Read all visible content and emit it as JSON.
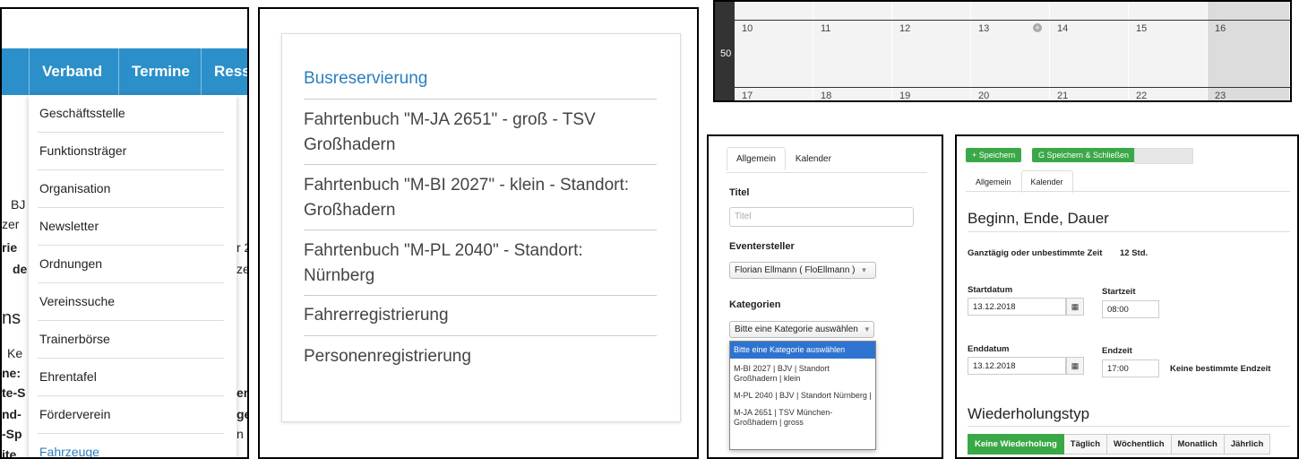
{
  "nav": {
    "tabs": [
      "Verband",
      "Termine",
      "Ress"
    ],
    "dropdown": [
      "Geschäftsstelle",
      "Funktionsträger",
      "Organisation",
      "Newsletter",
      "Ordnungen",
      "Vereinssuche",
      "Trainerbörse",
      "Ehrentafel",
      "Förderverein",
      "Fahrzeuge"
    ],
    "bg_fragments": [
      "BJ",
      "zer",
      "rie",
      "de",
      "ns",
      "Ke",
      "ne:",
      "te-S",
      "nd-",
      "-Sp",
      "ite",
      "r 2",
      "ze",
      "en",
      "ge",
      "n"
    ]
  },
  "list": {
    "items": [
      "Busreservierung",
      "Fahrtenbuch \"M-JA 2651\" - groß - TSV Großhadern",
      "Fahrtenbuch \"M-BI 2027\" - klein - Standort: Großhadern",
      "Fahrtenbuch \"M-PL 2040\" - Standort: Nürnberg",
      "Fahrerregistrierung",
      "Personenregistrierung"
    ]
  },
  "calendar": {
    "row1": [
      "10",
      "11",
      "12",
      "13",
      "14",
      "15",
      "16"
    ],
    "row2": [
      "17",
      "18",
      "19",
      "20",
      "21",
      "22",
      "23"
    ],
    "week": "50",
    "add_icon": "plus-circle-icon"
  },
  "event_form": {
    "tabs": [
      "Allgemein",
      "Kalender"
    ],
    "title_label": "Titel",
    "title_placeholder": "Titel",
    "creator_label": "Eventersteller",
    "creator_value": "Florian Ellmann ( FloEllmann )",
    "category_label": "Kategorien",
    "category_value": "Bitte eine Kategorie auswählen",
    "category_options": [
      "Bitte eine Kategorie auswählen",
      "M-BI 2027 | BJV | Standort Großhadern | klein",
      "M-PL 2040 | BJV | Standort Nürnberg |",
      "M-JA 2651 | TSV München-Großhadern | gross"
    ]
  },
  "calendar_form": {
    "buttons": [
      "+ Speichern",
      "G Speichern & Schließen"
    ],
    "tabs": [
      "Allgemein",
      "Kalender"
    ],
    "section1": "Beginn, Ende, Dauer",
    "allday_label": "Ganztägig oder unbestimmte Zeit",
    "duration": "12 Std.",
    "start_date_label": "Startdatum",
    "start_date": "13.12.2018",
    "start_time_label": "Startzeit",
    "start_time": "08:00",
    "end_date_label": "Enddatum",
    "end_date": "13.12.2018",
    "end_time_label": "Endzeit",
    "end_time": "17:00",
    "no_end_label": "Keine bestimmte Endzeit",
    "section2": "Wiederholungstyp",
    "repeat": [
      "Keine Wiederholung",
      "Täglich",
      "Wöchentlich",
      "Monatlich",
      "Jährlich"
    ],
    "colors": {
      "accent": "#3aa846",
      "nav": "#2b8fc9"
    }
  }
}
